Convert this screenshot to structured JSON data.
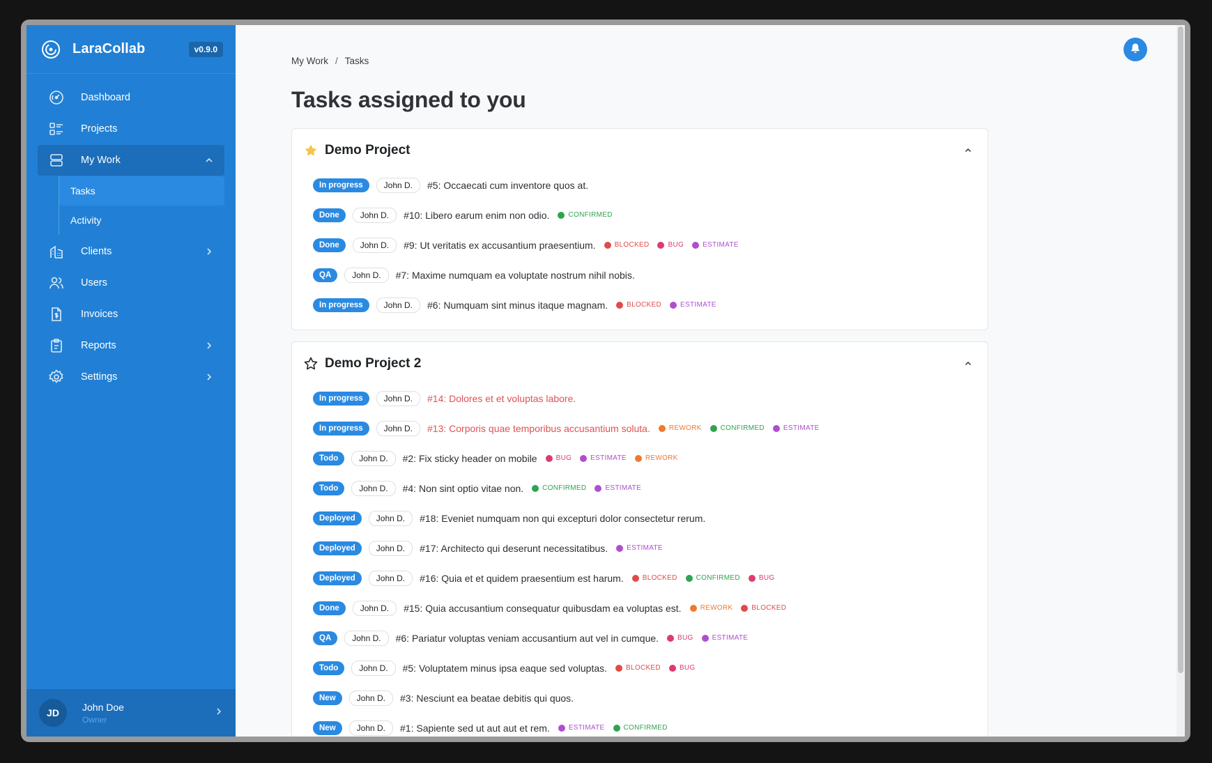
{
  "app": {
    "name": "LaraCollab",
    "version": "v0.9.0"
  },
  "sidebar": {
    "items": [
      {
        "label": "Dashboard",
        "icon": "dashboard-icon"
      },
      {
        "label": "Projects",
        "icon": "projects-icon"
      },
      {
        "label": "My Work",
        "icon": "my-work-icon",
        "expanded": true,
        "children": [
          {
            "label": "Tasks",
            "active": true
          },
          {
            "label": "Activity"
          }
        ]
      },
      {
        "label": "Clients",
        "icon": "clients-icon",
        "has_children": true
      },
      {
        "label": "Users",
        "icon": "users-icon"
      },
      {
        "label": "Invoices",
        "icon": "invoices-icon"
      },
      {
        "label": "Reports",
        "icon": "reports-icon",
        "has_children": true
      },
      {
        "label": "Settings",
        "icon": "settings-icon",
        "has_children": true
      }
    ],
    "user": {
      "initials": "JD",
      "name": "John Doe",
      "role": "Owner"
    }
  },
  "breadcrumb": {
    "parent": "My Work",
    "separator": "/",
    "current": "Tasks"
  },
  "page_title": "Tasks assigned to you",
  "colors": {
    "primary": "#2180d5",
    "status_badge": "#2a8ae2",
    "overdue_text": "#e05252",
    "label_colors": {
      "CONFIRMED": "#2ea44f",
      "BLOCKED": "#e04a4a",
      "BUG": "#dc3c6e",
      "ESTIMATE": "#b04ed0",
      "REWORK": "#ee7a30"
    }
  },
  "projects": [
    {
      "name": "Demo Project",
      "favorite": true,
      "tasks": [
        {
          "status": "In progress",
          "assignee": "John D.",
          "title": "#5: Occaecati cum inventore quos at.",
          "overdue": false,
          "labels": []
        },
        {
          "status": "Done",
          "assignee": "John D.",
          "title": "#10: Libero earum enim non odio.",
          "overdue": false,
          "labels": [
            "CONFIRMED"
          ]
        },
        {
          "status": "Done",
          "assignee": "John D.",
          "title": "#9: Ut veritatis ex accusantium praesentium.",
          "overdue": false,
          "labels": [
            "BLOCKED",
            "BUG",
            "ESTIMATE"
          ]
        },
        {
          "status": "QA",
          "assignee": "John D.",
          "title": "#7: Maxime numquam ea voluptate nostrum nihil nobis.",
          "overdue": false,
          "labels": []
        },
        {
          "status": "In progress",
          "assignee": "John D.",
          "title": "#6: Numquam sint minus itaque magnam.",
          "overdue": false,
          "labels": [
            "BLOCKED",
            "ESTIMATE"
          ]
        }
      ]
    },
    {
      "name": "Demo Project 2",
      "favorite": false,
      "tasks": [
        {
          "status": "In progress",
          "assignee": "John D.",
          "title": "#14: Dolores et et voluptas labore.",
          "overdue": true,
          "labels": []
        },
        {
          "status": "In progress",
          "assignee": "John D.",
          "title": "#13: Corporis quae temporibus accusantium soluta.",
          "overdue": true,
          "labels": [
            "REWORK",
            "CONFIRMED",
            "ESTIMATE"
          ]
        },
        {
          "status": "Todo",
          "assignee": "John D.",
          "title": "#2: Fix sticky header on mobile",
          "overdue": false,
          "labels": [
            "BUG",
            "ESTIMATE",
            "REWORK"
          ]
        },
        {
          "status": "Todo",
          "assignee": "John D.",
          "title": "#4: Non sint optio vitae non.",
          "overdue": false,
          "labels": [
            "CONFIRMED",
            "ESTIMATE"
          ]
        },
        {
          "status": "Deployed",
          "assignee": "John D.",
          "title": "#18: Eveniet numquam non qui excepturi dolor consectetur rerum.",
          "overdue": false,
          "labels": []
        },
        {
          "status": "Deployed",
          "assignee": "John D.",
          "title": "#17: Architecto qui deserunt necessitatibus.",
          "overdue": false,
          "labels": [
            "ESTIMATE"
          ]
        },
        {
          "status": "Deployed",
          "assignee": "John D.",
          "title": "#16: Quia et et quidem praesentium est harum.",
          "overdue": false,
          "labels": [
            "BLOCKED",
            "CONFIRMED",
            "BUG"
          ]
        },
        {
          "status": "Done",
          "assignee": "John D.",
          "title": "#15: Quia accusantium consequatur quibusdam ea voluptas est.",
          "overdue": false,
          "labels": [
            "REWORK",
            "BLOCKED"
          ]
        },
        {
          "status": "QA",
          "assignee": "John D.",
          "title": "#6: Pariatur voluptas veniam accusantium aut vel in cumque.",
          "overdue": false,
          "labels": [
            "BUG",
            "ESTIMATE"
          ]
        },
        {
          "status": "Todo",
          "assignee": "John D.",
          "title": "#5: Voluptatem minus ipsa eaque sed voluptas.",
          "overdue": false,
          "labels": [
            "BLOCKED",
            "BUG"
          ]
        },
        {
          "status": "New",
          "assignee": "John D.",
          "title": "#3: Nesciunt ea beatae debitis qui quos.",
          "overdue": false,
          "labels": []
        },
        {
          "status": "New",
          "assignee": "John D.",
          "title": "#1: Sapiente sed ut aut aut et rem.",
          "overdue": false,
          "labels": [
            "ESTIMATE",
            "CONFIRMED"
          ]
        }
      ]
    }
  ]
}
